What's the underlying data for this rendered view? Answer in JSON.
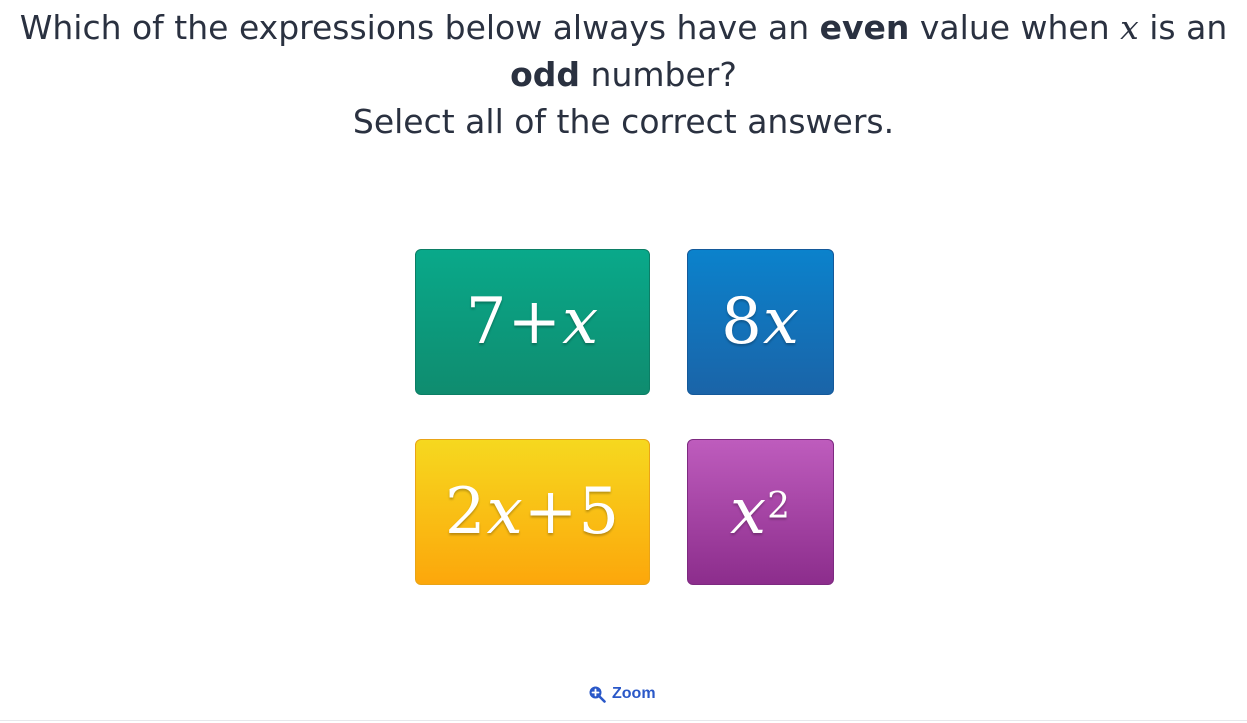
{
  "question": {
    "part1": "Which of the expressions below always have an ",
    "bold1": "even",
    "part2": " value when ",
    "variable": "x",
    "part3": " is an",
    "bold2": "odd",
    "part4": " number?",
    "instruction": "Select all of the correct answers."
  },
  "answers": [
    {
      "prefix": "7+",
      "var": "x",
      "suffix": "",
      "sup": "",
      "color": "#0a9c7e"
    },
    {
      "prefix": "8",
      "var": "x",
      "suffix": "",
      "sup": "",
      "color": "#1470b8"
    },
    {
      "prefix": "2",
      "var": "x",
      "suffix": "+5",
      "sup": "",
      "color": "#f9be14"
    },
    {
      "prefix": "",
      "var": "x",
      "suffix": "",
      "sup": "2",
      "color": "#a646a5"
    }
  ],
  "zoom": {
    "label": "Zoom",
    "icon": "zoom-in-icon"
  },
  "colors": {
    "text": "#2a3140",
    "link": "#2a58c8"
  }
}
